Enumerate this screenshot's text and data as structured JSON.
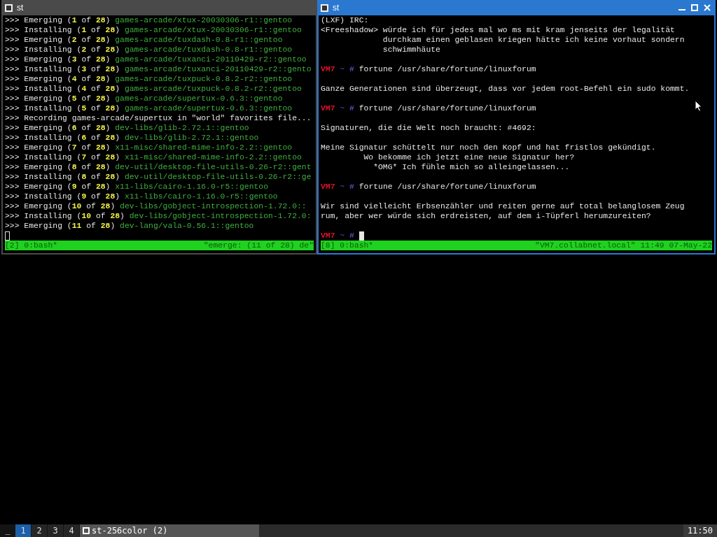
{
  "windows": [
    {
      "title": "st",
      "focused": false,
      "lines": [
        {
          "kind": "text",
          "segments": [
            {
              "kind": "plain",
              "text": ">>> Emerging ("
            },
            {
              "kind": "num",
              "text": "1"
            },
            {
              "kind": "plain",
              "text": " of "
            },
            {
              "kind": "num",
              "text": "28"
            },
            {
              "kind": "plain",
              "text": ") "
            },
            {
              "kind": "pkg",
              "text": "games-arcade/xtux-20030306-r1::gentoo"
            }
          ]
        },
        {
          "kind": "text",
          "segments": [
            {
              "kind": "plain",
              "text": ">>> Installing ("
            },
            {
              "kind": "num",
              "text": "1"
            },
            {
              "kind": "plain",
              "text": " of "
            },
            {
              "kind": "num",
              "text": "28"
            },
            {
              "kind": "plain",
              "text": ") "
            },
            {
              "kind": "pkg",
              "text": "games-arcade/xtux-20030306-r1::gentoo"
            }
          ]
        },
        {
          "kind": "text",
          "segments": [
            {
              "kind": "plain",
              "text": ">>> Emerging ("
            },
            {
              "kind": "num",
              "text": "2"
            },
            {
              "kind": "plain",
              "text": " of "
            },
            {
              "kind": "num",
              "text": "28"
            },
            {
              "kind": "plain",
              "text": ") "
            },
            {
              "kind": "pkg",
              "text": "games-arcade/tuxdash-0.8-r1::gentoo"
            }
          ]
        },
        {
          "kind": "text",
          "segments": [
            {
              "kind": "plain",
              "text": ">>> Installing ("
            },
            {
              "kind": "num",
              "text": "2"
            },
            {
              "kind": "plain",
              "text": " of "
            },
            {
              "kind": "num",
              "text": "28"
            },
            {
              "kind": "plain",
              "text": ") "
            },
            {
              "kind": "pkg",
              "text": "games-arcade/tuxdash-0.8-r1::gentoo"
            }
          ]
        },
        {
          "kind": "text",
          "segments": [
            {
              "kind": "plain",
              "text": ">>> Emerging ("
            },
            {
              "kind": "num",
              "text": "3"
            },
            {
              "kind": "plain",
              "text": " of "
            },
            {
              "kind": "num",
              "text": "28"
            },
            {
              "kind": "plain",
              "text": ") "
            },
            {
              "kind": "pkg",
              "text": "games-arcade/tuxanci-20110429-r2::gentoo"
            }
          ]
        },
        {
          "kind": "text",
          "segments": [
            {
              "kind": "plain",
              "text": ">>> Installing ("
            },
            {
              "kind": "num",
              "text": "3"
            },
            {
              "kind": "plain",
              "text": " of "
            },
            {
              "kind": "num",
              "text": "28"
            },
            {
              "kind": "plain",
              "text": ") "
            },
            {
              "kind": "pkg",
              "text": "games-arcade/tuxanci-20110429-r2::gento"
            }
          ]
        },
        {
          "kind": "text",
          "segments": [
            {
              "kind": "plain",
              "text": ">>> Emerging ("
            },
            {
              "kind": "num",
              "text": "4"
            },
            {
              "kind": "plain",
              "text": " of "
            },
            {
              "kind": "num",
              "text": "28"
            },
            {
              "kind": "plain",
              "text": ") "
            },
            {
              "kind": "pkg",
              "text": "games-arcade/tuxpuck-0.8.2-r2::gentoo"
            }
          ]
        },
        {
          "kind": "text",
          "segments": [
            {
              "kind": "plain",
              "text": ">>> Installing ("
            },
            {
              "kind": "num",
              "text": "4"
            },
            {
              "kind": "plain",
              "text": " of "
            },
            {
              "kind": "num",
              "text": "28"
            },
            {
              "kind": "plain",
              "text": ") "
            },
            {
              "kind": "pkg",
              "text": "games-arcade/tuxpuck-0.8.2-r2::gentoo"
            }
          ]
        },
        {
          "kind": "text",
          "segments": [
            {
              "kind": "plain",
              "text": ">>> Emerging ("
            },
            {
              "kind": "num",
              "text": "5"
            },
            {
              "kind": "plain",
              "text": " of "
            },
            {
              "kind": "num",
              "text": "28"
            },
            {
              "kind": "plain",
              "text": ") "
            },
            {
              "kind": "pkg",
              "text": "games-arcade/supertux-0.6.3::gentoo"
            }
          ]
        },
        {
          "kind": "text",
          "segments": [
            {
              "kind": "plain",
              "text": ">>> Installing ("
            },
            {
              "kind": "num",
              "text": "5"
            },
            {
              "kind": "plain",
              "text": " of "
            },
            {
              "kind": "num",
              "text": "28"
            },
            {
              "kind": "plain",
              "text": ") "
            },
            {
              "kind": "pkg",
              "text": "games-arcade/supertux-0.6.3::gentoo"
            }
          ]
        },
        {
          "kind": "text",
          "segments": [
            {
              "kind": "plain",
              "text": ">>> Recording games-arcade/supertux in \"world\" favorites file..."
            }
          ]
        },
        {
          "kind": "text",
          "segments": [
            {
              "kind": "plain",
              "text": ">>> Emerging ("
            },
            {
              "kind": "num",
              "text": "6"
            },
            {
              "kind": "plain",
              "text": " of "
            },
            {
              "kind": "num",
              "text": "28"
            },
            {
              "kind": "plain",
              "text": ") "
            },
            {
              "kind": "pkg",
              "text": "dev-libs/glib-2.72.1::gentoo"
            }
          ]
        },
        {
          "kind": "text",
          "segments": [
            {
              "kind": "plain",
              "text": ">>> Installing ("
            },
            {
              "kind": "num",
              "text": "6"
            },
            {
              "kind": "plain",
              "text": " of "
            },
            {
              "kind": "num",
              "text": "28"
            },
            {
              "kind": "plain",
              "text": ") "
            },
            {
              "kind": "pkg",
              "text": "dev-libs/glib-2.72.1::gentoo"
            }
          ]
        },
        {
          "kind": "text",
          "segments": [
            {
              "kind": "plain",
              "text": ">>> Emerging ("
            },
            {
              "kind": "num",
              "text": "7"
            },
            {
              "kind": "plain",
              "text": " of "
            },
            {
              "kind": "num",
              "text": "28"
            },
            {
              "kind": "plain",
              "text": ") "
            },
            {
              "kind": "pkg",
              "text": "x11-misc/shared-mime-info-2.2::gentoo"
            }
          ]
        },
        {
          "kind": "text",
          "segments": [
            {
              "kind": "plain",
              "text": ">>> Installing ("
            },
            {
              "kind": "num",
              "text": "7"
            },
            {
              "kind": "plain",
              "text": " of "
            },
            {
              "kind": "num",
              "text": "28"
            },
            {
              "kind": "plain",
              "text": ") "
            },
            {
              "kind": "pkg",
              "text": "x11-misc/shared-mime-info-2.2::gentoo"
            }
          ]
        },
        {
          "kind": "text",
          "segments": [
            {
              "kind": "plain",
              "text": ">>> Emerging ("
            },
            {
              "kind": "num",
              "text": "8"
            },
            {
              "kind": "plain",
              "text": " of "
            },
            {
              "kind": "num",
              "text": "28"
            },
            {
              "kind": "plain",
              "text": ") "
            },
            {
              "kind": "pkg",
              "text": "dev-util/desktop-file-utils-0.26-r2::gent"
            }
          ]
        },
        {
          "kind": "text",
          "segments": [
            {
              "kind": "plain",
              "text": ">>> Installing ("
            },
            {
              "kind": "num",
              "text": "8"
            },
            {
              "kind": "plain",
              "text": " of "
            },
            {
              "kind": "num",
              "text": "28"
            },
            {
              "kind": "plain",
              "text": ") "
            },
            {
              "kind": "pkg",
              "text": "dev-util/desktop-file-utils-0.26-r2::ge"
            }
          ]
        },
        {
          "kind": "text",
          "segments": [
            {
              "kind": "plain",
              "text": ">>> Emerging ("
            },
            {
              "kind": "num",
              "text": "9"
            },
            {
              "kind": "plain",
              "text": " of "
            },
            {
              "kind": "num",
              "text": "28"
            },
            {
              "kind": "plain",
              "text": ") "
            },
            {
              "kind": "pkg",
              "text": "x11-libs/cairo-1.16.0-r5::gentoo"
            }
          ]
        },
        {
          "kind": "text",
          "segments": [
            {
              "kind": "plain",
              "text": ">>> Installing ("
            },
            {
              "kind": "num",
              "text": "9"
            },
            {
              "kind": "plain",
              "text": " of "
            },
            {
              "kind": "num",
              "text": "28"
            },
            {
              "kind": "plain",
              "text": ") "
            },
            {
              "kind": "pkg",
              "text": "x11-libs/cairo-1.16.0-r5::gentoo"
            }
          ]
        },
        {
          "kind": "text",
          "segments": [
            {
              "kind": "plain",
              "text": ">>> Emerging ("
            },
            {
              "kind": "num",
              "text": "10"
            },
            {
              "kind": "plain",
              "text": " of "
            },
            {
              "kind": "num",
              "text": "28"
            },
            {
              "kind": "plain",
              "text": ") "
            },
            {
              "kind": "pkg",
              "text": "dev-libs/gobject-introspection-1.72.0::"
            }
          ]
        },
        {
          "kind": "text",
          "segments": [
            {
              "kind": "plain",
              "text": ">>> Installing ("
            },
            {
              "kind": "num",
              "text": "10"
            },
            {
              "kind": "plain",
              "text": " of "
            },
            {
              "kind": "num",
              "text": "28"
            },
            {
              "kind": "plain",
              "text": ") "
            },
            {
              "kind": "pkg",
              "text": "dev-libs/gobject-introspection-1.72.0:"
            }
          ]
        },
        {
          "kind": "text",
          "segments": [
            {
              "kind": "plain",
              "text": ">>> Emerging ("
            },
            {
              "kind": "num",
              "text": "11"
            },
            {
              "kind": "plain",
              "text": " of "
            },
            {
              "kind": "num",
              "text": "28"
            },
            {
              "kind": "plain",
              "text": ") "
            },
            {
              "kind": "pkg",
              "text": "dev-lang/vala-0.56.1::gentoo"
            }
          ]
        },
        {
          "kind": "cursor"
        }
      ],
      "status": {
        "left": "[2] 0:bash*",
        "right": "\"emerge: (11 of 28) de\""
      }
    },
    {
      "title": "st",
      "focused": true,
      "lines": [
        {
          "kind": "text",
          "segments": [
            {
              "kind": "plain",
              "text": "(LXF) IRC:"
            }
          ]
        },
        {
          "kind": "text",
          "segments": [
            {
              "kind": "plain",
              "text": "<Freeshadow> würde ich für jedes mal wo ms mit kram jenseits der legalität"
            }
          ]
        },
        {
          "kind": "text",
          "segments": [
            {
              "kind": "plain",
              "text": "             durchkam einen geblasen kriegen hätte ich keine vorhaut sondern"
            }
          ]
        },
        {
          "kind": "text",
          "segments": [
            {
              "kind": "plain",
              "text": "             schwimmhäute"
            }
          ]
        },
        {
          "kind": "blank"
        },
        {
          "kind": "text",
          "segments": [
            {
              "kind": "host",
              "text": "VM7"
            },
            {
              "kind": "path",
              "text": " ~ "
            },
            {
              "kind": "sym",
              "text": "#"
            },
            {
              "kind": "plain",
              "text": " fortune /usr/share/fortune/linuxforum"
            }
          ]
        },
        {
          "kind": "blank"
        },
        {
          "kind": "text",
          "segments": [
            {
              "kind": "plain",
              "text": "Ganze Generationen sind überzeugt, dass vor jedem root-Befehl ein sudo kommt."
            }
          ]
        },
        {
          "kind": "blank"
        },
        {
          "kind": "text",
          "segments": [
            {
              "kind": "host",
              "text": "VM7"
            },
            {
              "kind": "path",
              "text": " ~ "
            },
            {
              "kind": "sym",
              "text": "#"
            },
            {
              "kind": "plain",
              "text": " fortune /usr/share/fortune/linuxforum"
            }
          ]
        },
        {
          "kind": "blank"
        },
        {
          "kind": "text",
          "segments": [
            {
              "kind": "plain",
              "text": "Signaturen, die die Welt noch braucht: #4692:"
            }
          ]
        },
        {
          "kind": "blank"
        },
        {
          "kind": "text",
          "segments": [
            {
              "kind": "plain",
              "text": "Meine Signatur schüttelt nur noch den Kopf und hat fristlos gekündigt."
            }
          ]
        },
        {
          "kind": "text",
          "segments": [
            {
              "kind": "plain",
              "text": "         Wo bekomme ich jetzt eine neue Signatur her?"
            }
          ]
        },
        {
          "kind": "text",
          "segments": [
            {
              "kind": "plain",
              "text": "           *OMG* Ich fühle mich so alleingelassen..."
            }
          ]
        },
        {
          "kind": "blank"
        },
        {
          "kind": "text",
          "segments": [
            {
              "kind": "host",
              "text": "VM7"
            },
            {
              "kind": "path",
              "text": " ~ "
            },
            {
              "kind": "sym",
              "text": "#"
            },
            {
              "kind": "plain",
              "text": " fortune /usr/share/fortune/linuxforum"
            }
          ]
        },
        {
          "kind": "blank"
        },
        {
          "kind": "text",
          "segments": [
            {
              "kind": "plain",
              "text": "Wir sind vielleicht Erbsenzähler und reiten gerne auf total belanglosem Zeug"
            }
          ]
        },
        {
          "kind": "text",
          "segments": [
            {
              "kind": "plain",
              "text": "rum, aber wer würde sich erdreisten, auf dem i-Tüpferl herumzureiten?"
            }
          ]
        },
        {
          "kind": "blank"
        },
        {
          "kind": "input",
          "segments": [
            {
              "kind": "host",
              "text": "VM7"
            },
            {
              "kind": "path",
              "text": " ~ "
            },
            {
              "kind": "sym",
              "text": "#"
            }
          ]
        }
      ],
      "status": {
        "left": "[8] 0:bash*",
        "right": "\"VM7.collabnet.local\" 11:49 07-May-22"
      }
    }
  ],
  "taskbar": {
    "layout_symbol": "_",
    "workspaces": [
      {
        "label": "1",
        "selected": true
      },
      {
        "label": "2",
        "selected": false
      },
      {
        "label": "3",
        "selected": false
      },
      {
        "label": "4",
        "selected": false
      }
    ],
    "task": {
      "title": "st-256color (2)"
    },
    "clock": "11:50"
  }
}
